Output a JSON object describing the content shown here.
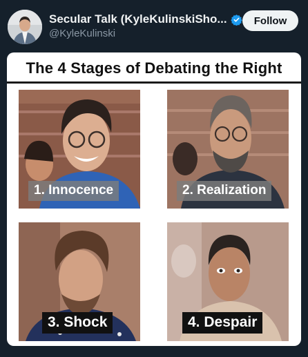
{
  "post": {
    "display_name": "Secular Talk (KyleKulinskiSho...",
    "handle": "@KyleKulinski",
    "follow_label": "Follow"
  },
  "meme": {
    "title": "The 4 Stages of Debating the Right",
    "stages": [
      {
        "caption": "1. Innocence"
      },
      {
        "caption": "2. Realization"
      },
      {
        "caption": "3. Shock"
      },
      {
        "caption": "4. Despair"
      }
    ]
  },
  "colors": {
    "background": "#15202b",
    "verified": "#1d9bf0",
    "follow_button": "#eff3f4"
  },
  "icons": {
    "verified": "verified-badge-icon"
  }
}
